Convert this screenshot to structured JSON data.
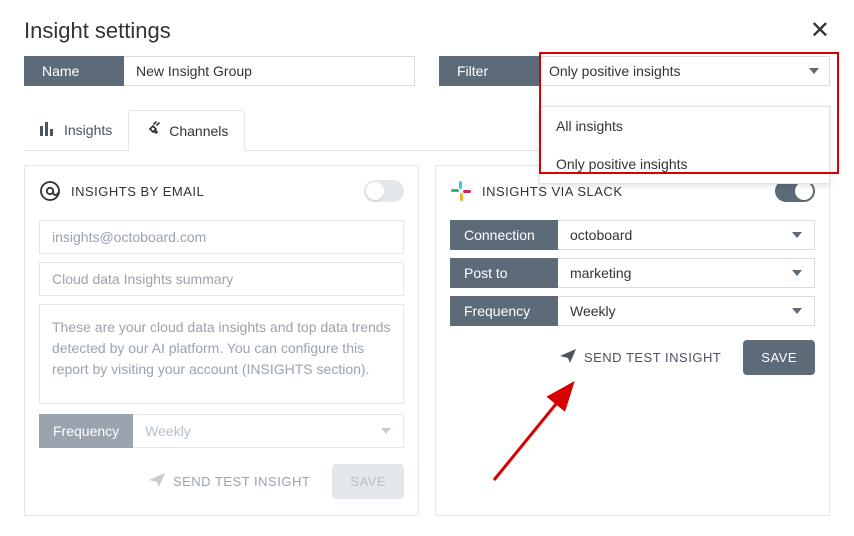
{
  "header": {
    "title": "Insight settings"
  },
  "name_field": {
    "label": "Name",
    "value": "New Insight Group"
  },
  "filter_field": {
    "label": "Filter",
    "selected": "Only positive insights",
    "options": [
      "All insights",
      "Only positive insights"
    ]
  },
  "tabs": {
    "insights": "Insights",
    "channels": "Channels"
  },
  "email_panel": {
    "title": "INSIGHTS BY EMAIL",
    "recipient": "insights@octoboard.com",
    "subject": "Cloud data Insights summary",
    "body": "These are your cloud data insights and top data trends detected by our AI platform. You can configure this report by visiting your account (INSIGHTS section).",
    "freq_label": "Frequency",
    "frequency": "Weekly",
    "send_label": "SEND TEST INSIGHT",
    "save_label": "SAVE"
  },
  "slack_panel": {
    "title": "INSIGHTS VIA SLACK",
    "rows": {
      "connection_label": "Connection",
      "connection_value": "octoboard",
      "postto_label": "Post to",
      "postto_value": "marketing",
      "frequency_label": "Frequency",
      "frequency_value": "Weekly"
    },
    "send_label": "SEND TEST INSIGHT",
    "save_label": "SAVE"
  }
}
